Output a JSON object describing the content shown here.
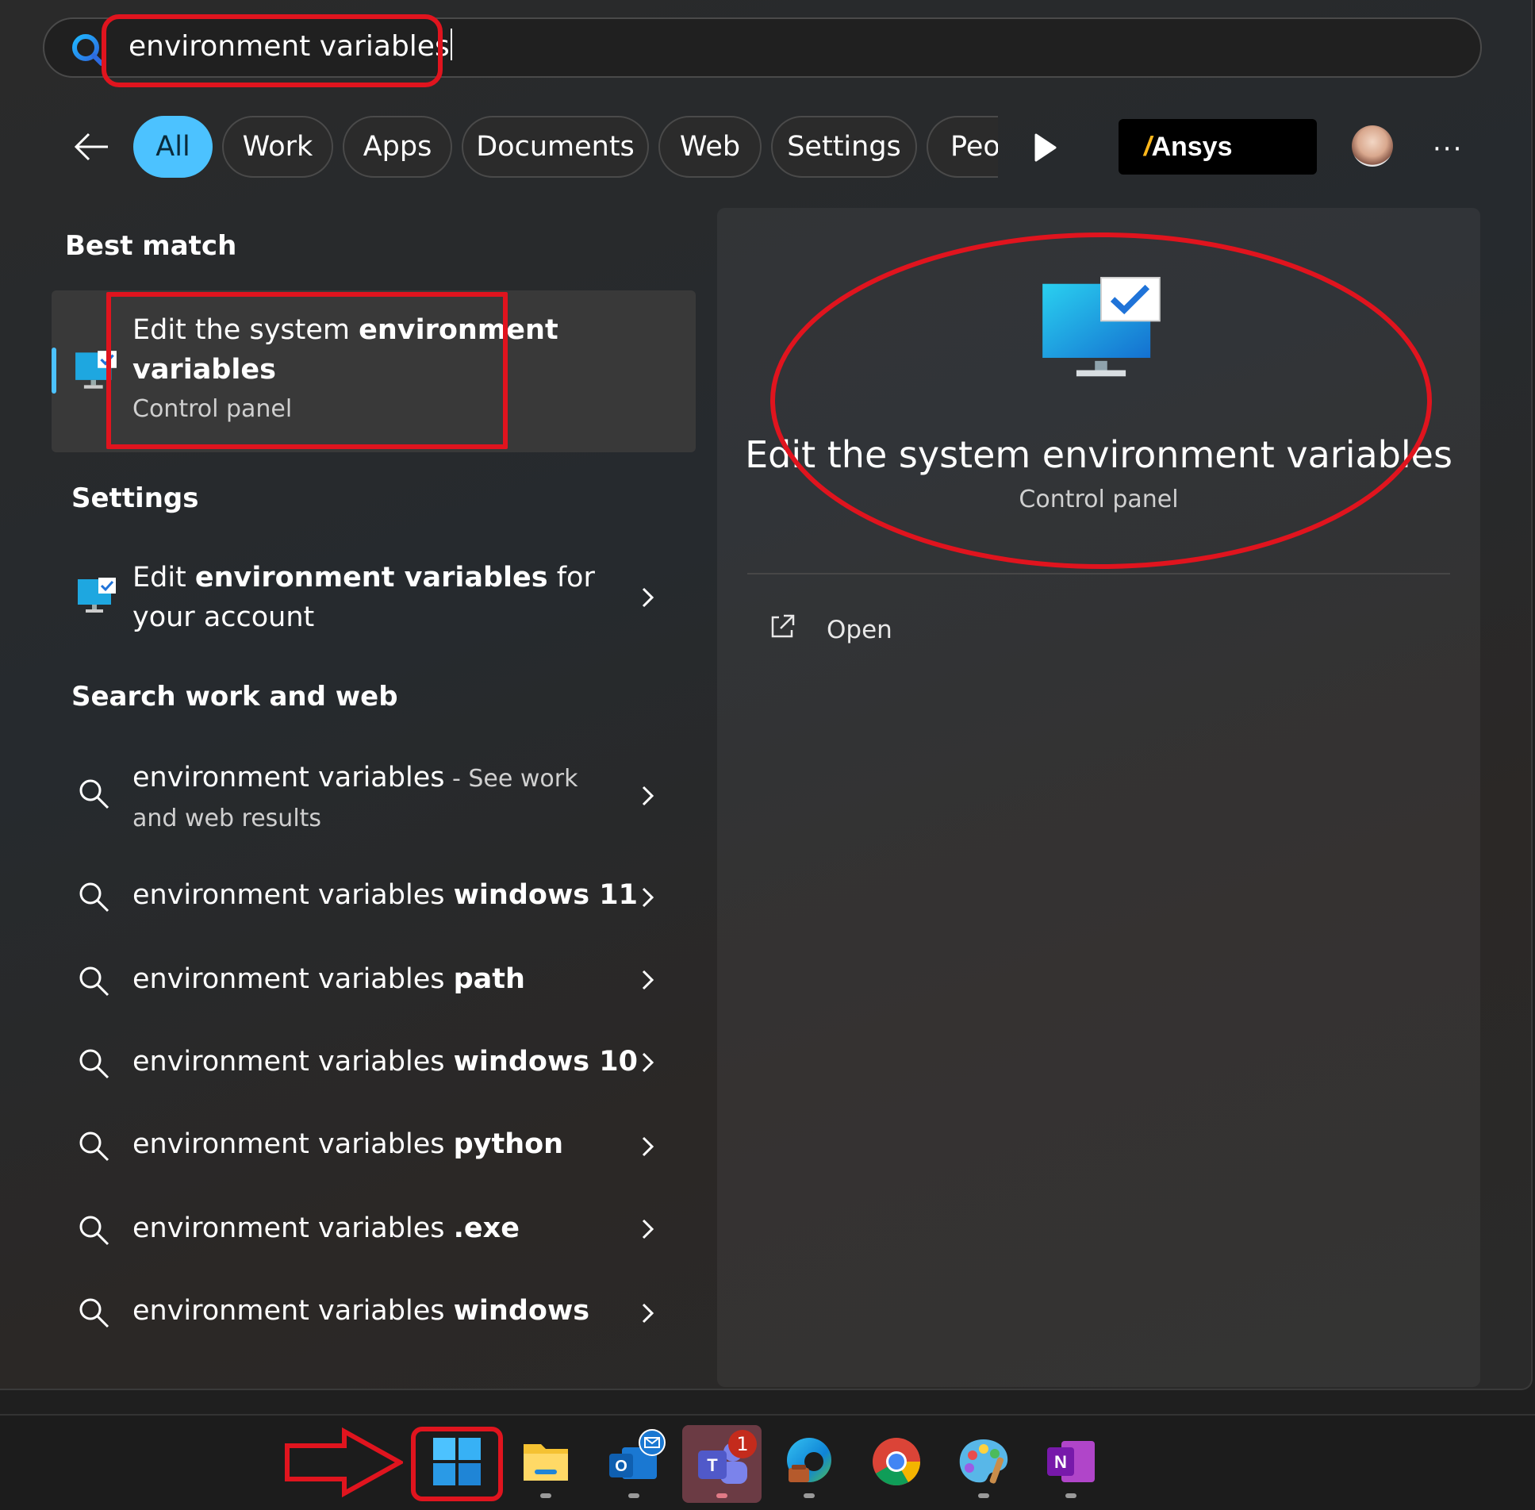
{
  "search": {
    "query": "environment variables"
  },
  "filters": [
    "All",
    "Work",
    "Apps",
    "Documents",
    "Web",
    "Settings",
    "Peo"
  ],
  "brand": {
    "logo_text": "Ansys"
  },
  "more_label": "···",
  "best_match": {
    "section_title": "Best match",
    "title_normal": "Edit the system ",
    "title_bold_1": "environment",
    "title_bold_2": "variables",
    "subtitle": "Control panel"
  },
  "settings": {
    "section_title": "Settings",
    "item_pre": "Edit ",
    "item_bold": "environment variables",
    "item_post": " for",
    "item_line2": "your account"
  },
  "web": {
    "section_title": "Search work and web",
    "first": {
      "query": "environment variables",
      "suffix": " - See work",
      "line2": "and web results"
    },
    "suggestions": [
      {
        "prefix": "environment variables ",
        "bold": "windows 11"
      },
      {
        "prefix": "environment variables ",
        "bold": "path"
      },
      {
        "prefix": "environment variables ",
        "bold": "windows 10"
      },
      {
        "prefix": "environment variables ",
        "bold": "python"
      },
      {
        "prefix": "environment variables ",
        "bold": ".exe"
      },
      {
        "prefix": "environment variables ",
        "bold": "windows"
      }
    ]
  },
  "detail": {
    "title": "Edit the system environment variables",
    "subtitle": "Control panel",
    "open_label": "Open"
  },
  "taskbar": {
    "teams_badge": "1",
    "apps": [
      "start-icon",
      "file-explorer-icon",
      "outlook-icon",
      "teams-icon",
      "edge-icon",
      "chrome-icon",
      "paint-icon",
      "onenote-icon"
    ]
  },
  "colors": {
    "accent": "#4cc2ff",
    "annotation_red": "#e0141e",
    "background": "#2a2a2a"
  }
}
